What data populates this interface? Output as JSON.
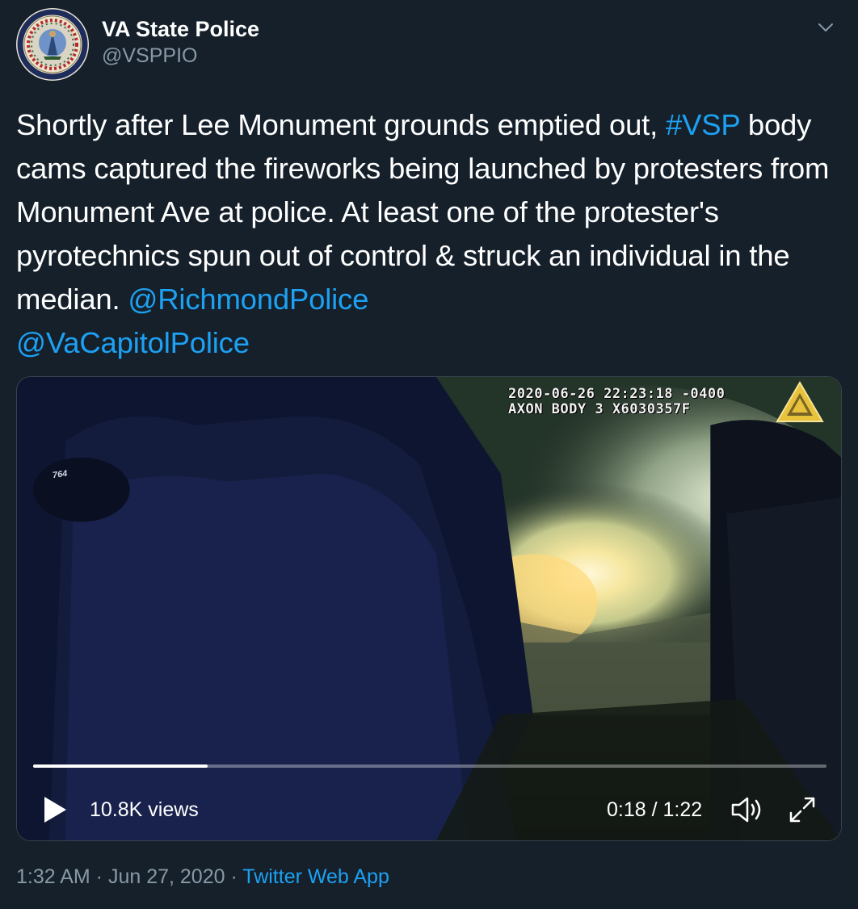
{
  "author": {
    "name": "VA State Police",
    "handle": "@VSPPIO",
    "avatar_icon": "virginia-state-seal-icon"
  },
  "menu_icon": "chevron-down-icon",
  "tweet": {
    "text_parts": [
      "Shortly after Lee Monument grounds emptied out, ",
      "#VSP",
      " body cams captured the fireworks being launched by protesters from Monument Ave at police. At least one of the protester's pyrotechnics spun out of control & struck an individual in the median. ",
      "@RichmondPolice",
      "@VaCapitolPolice"
    ],
    "link_color": "#1da1f2"
  },
  "video": {
    "overlay_line1": "2020-06-26 22:23:18 -0400",
    "overlay_line2": "AXON BODY 3 X6030357F",
    "helmet_text": "764",
    "views": "10.8K views",
    "time": "0:18 / 1:22",
    "progress_fraction": 0.22,
    "play_icon": "play-icon",
    "volume_icon": "volume-icon",
    "fullscreen_icon": "fullscreen-icon"
  },
  "footer": {
    "time": "1:32 AM",
    "separator": " · ",
    "date": "Jun 27, 2020",
    "source": "Twitter Web App"
  },
  "colors": {
    "background": "#15202b",
    "secondary_text": "#8899a6",
    "accent": "#1da1f2"
  }
}
